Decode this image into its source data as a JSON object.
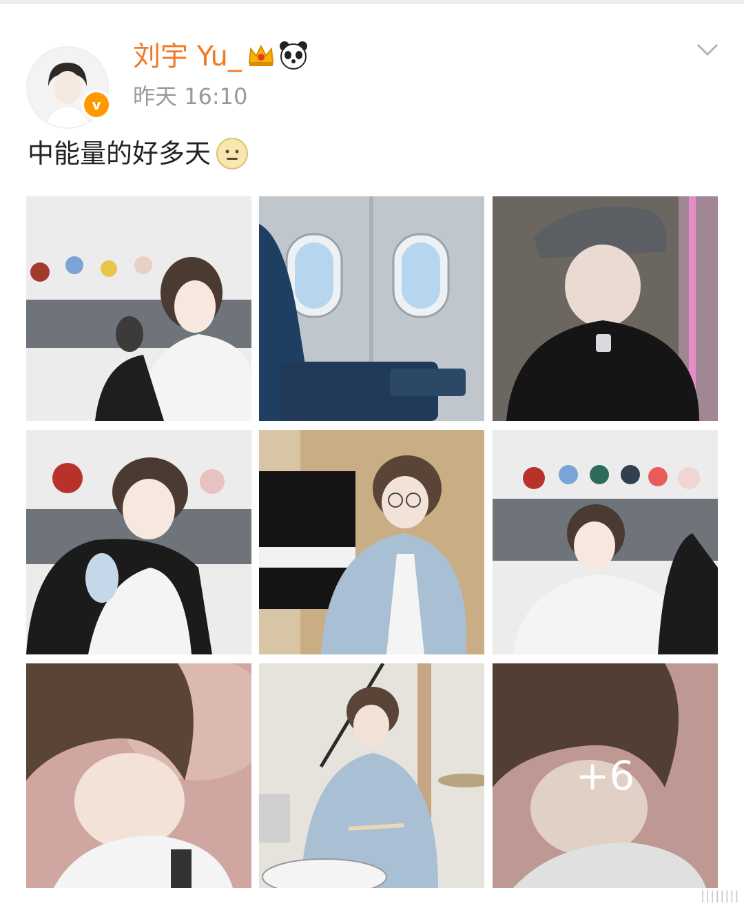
{
  "post": {
    "username": "刘宇 Yu_",
    "timestamp": "昨天 16:10",
    "text": "中能量的好多天",
    "badges": [
      "crown-icon",
      "panda-icon",
      "verified-v-icon"
    ],
    "verified_badge_letter": "v",
    "text_emoji": "face-emoji-icon",
    "more_count_label": "+6",
    "colors": {
      "username": "#f07b26",
      "verified": "#ff9900",
      "timestamp": "#999999",
      "text": "#222222"
    }
  },
  "photos": [
    {
      "subject": "photo-dolls-white-tee"
    },
    {
      "subject": "photo-airplane-window"
    },
    {
      "subject": "photo-black-cap"
    },
    {
      "subject": "photo-doll-hug"
    },
    {
      "subject": "photo-piano-denim"
    },
    {
      "subject": "photo-doll-shelf-point"
    },
    {
      "subject": "photo-closeup-pillow"
    },
    {
      "subject": "photo-drums"
    },
    {
      "subject": "photo-closeup-more"
    }
  ]
}
